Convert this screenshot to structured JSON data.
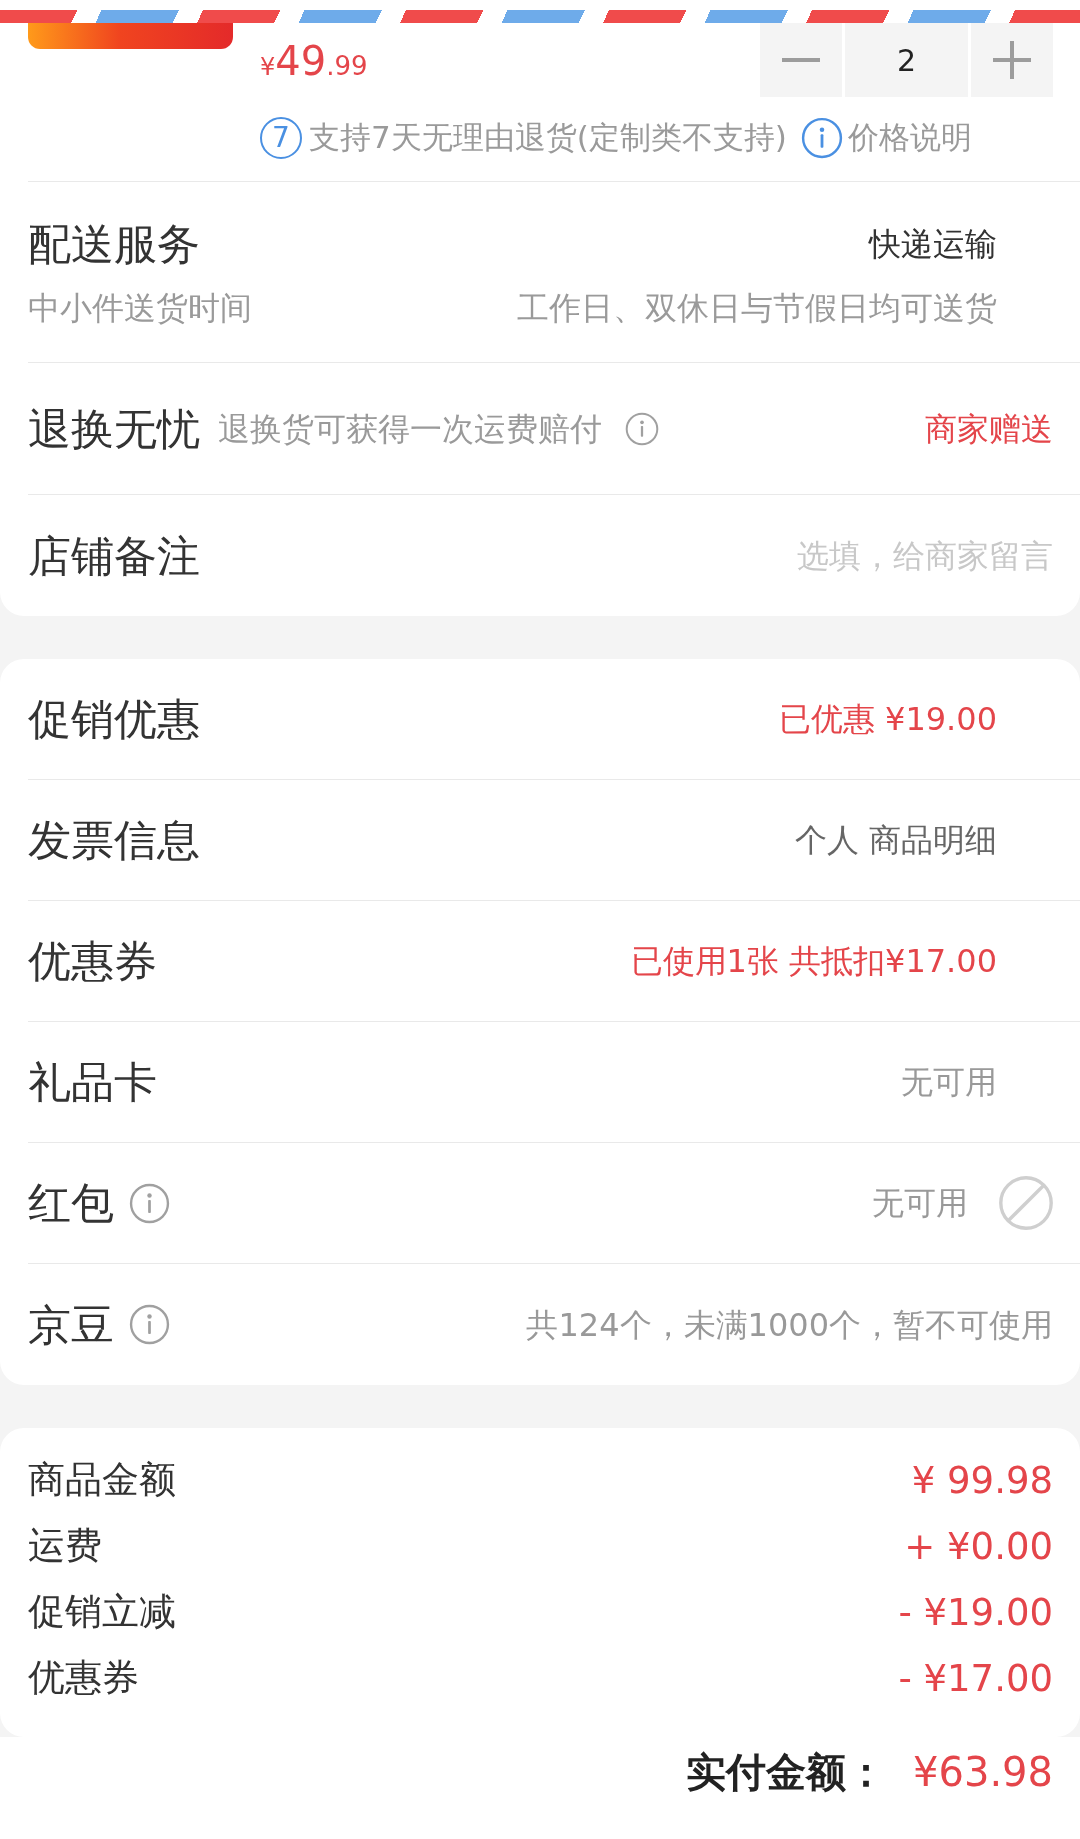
{
  "product": {
    "price": {
      "symbol": "¥",
      "integer": "49",
      "fraction": ".99"
    },
    "quantity": "2",
    "return_badge": "7",
    "return_policy": "支持7天无理由退货(定制类不支持)",
    "price_note": "价格说明"
  },
  "order_options": [
    {
      "kind": "delivery",
      "title": "配送服务",
      "value": {
        "text": "快递运输",
        "color": "#333333"
      },
      "subtitle": "中小件送货时间",
      "detail": "工作日、双休日与节假日均可送货"
    },
    {
      "kind": "service",
      "title": "退换无忧",
      "subtitle": "退换货可获得一次运费赔付",
      "info": true,
      "value": {
        "text": "商家赠送",
        "color": "#e4454a"
      }
    },
    {
      "kind": "remark",
      "title": "店铺备注",
      "placeholder": "选填，给商家留言"
    }
  ],
  "discounts": [
    {
      "kind": "value",
      "title": "促销优惠",
      "info": false,
      "value": {
        "text": "已优惠 ¥19.00",
        "color": "#e4454a"
      }
    },
    {
      "kind": "value",
      "title": "发票信息",
      "info": false,
      "value": {
        "text": "个人 商品明细",
        "color": "#666666"
      }
    },
    {
      "kind": "value",
      "title": "优惠券",
      "info": false,
      "value": {
        "text": "已使用1张 共抵扣¥17.00",
        "color": "#e4454a"
      }
    },
    {
      "kind": "value",
      "title": "礼品卡",
      "info": false,
      "value": {
        "text": "无可用",
        "color": "#999999"
      }
    },
    {
      "kind": "unavailable",
      "title": "红包",
      "info": true,
      "value": {
        "text": "无可用",
        "color": "#999999"
      }
    },
    {
      "kind": "note",
      "title": "京豆",
      "info": true,
      "value": {
        "text": "共124个，未满1000个，暂不可使用",
        "color": "#999999"
      }
    }
  ],
  "summary": [
    {
      "label": "商品金额",
      "amount": "¥ 99.98"
    },
    {
      "label": "运费",
      "amount": "+ ¥0.00"
    },
    {
      "label": "促销立减",
      "amount": "- ¥19.00"
    },
    {
      "label": "优惠券",
      "amount": "- ¥17.00"
    }
  ],
  "total": {
    "label": "实付金额：",
    "amount": "¥63.98"
  }
}
